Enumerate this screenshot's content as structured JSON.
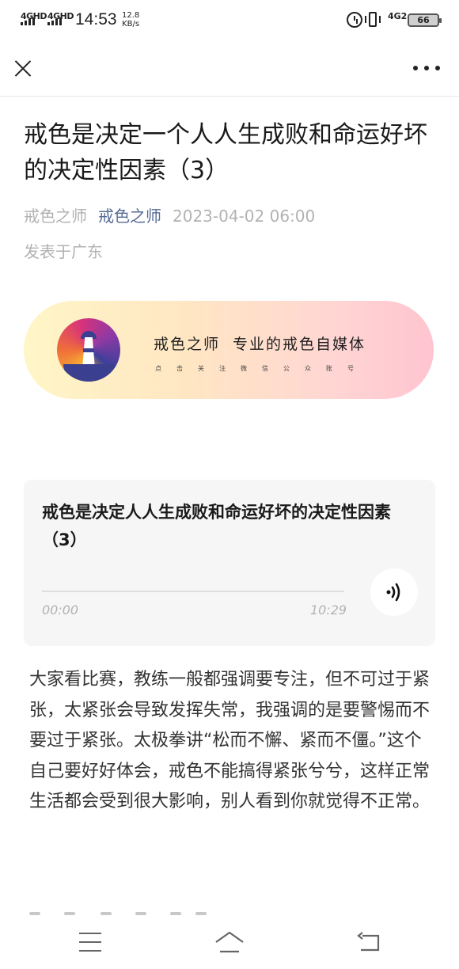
{
  "status_bar": {
    "signal_1": "4GHD",
    "signal_2": "4GHD",
    "time": "14:53",
    "net_speed_value": "12.8",
    "net_speed_unit": "KB/s",
    "signal_3": "4G2",
    "battery": "66"
  },
  "icons": {
    "close": "close-icon",
    "more": "more-dots-icon",
    "play": "audio-wave-icon",
    "menu": "hamburger-icon",
    "home": "home-icon",
    "back": "back-icon"
  },
  "article": {
    "title": "戒色是决定一个人人生成败和命运好坏的决定性因素（3）",
    "account_name": "戒色之师",
    "author": "戒色之师",
    "date": "2023-04-02 06:00",
    "location": "发表于广东"
  },
  "banner": {
    "name": "戒色之师",
    "slogan": "专业的戒色自媒体",
    "subtitle": "点击关注微信公众账号"
  },
  "audio": {
    "title": "戒色是决定人人生成败和命运好坏的决定性因素（3）",
    "current_time": "00:00",
    "duration": "10:29",
    "progress": 0
  },
  "body": {
    "paragraph_1": "大家看比赛，教练一般都强调要专注，但不可过于紧张，太紧张会导致发挥失常，我强调的是要警惕而不要过于紧张。太极拳讲“松而不懈、紧而不僵。”这个自己要好好体会，戒色不能搞得紧张兮兮，这样正常生活都会受到很大影响，别人看到你就觉得不正常。"
  },
  "colors": {
    "link": "#576b95",
    "meta": "#b2b2b2",
    "card_bg": "#f6f6f6"
  }
}
